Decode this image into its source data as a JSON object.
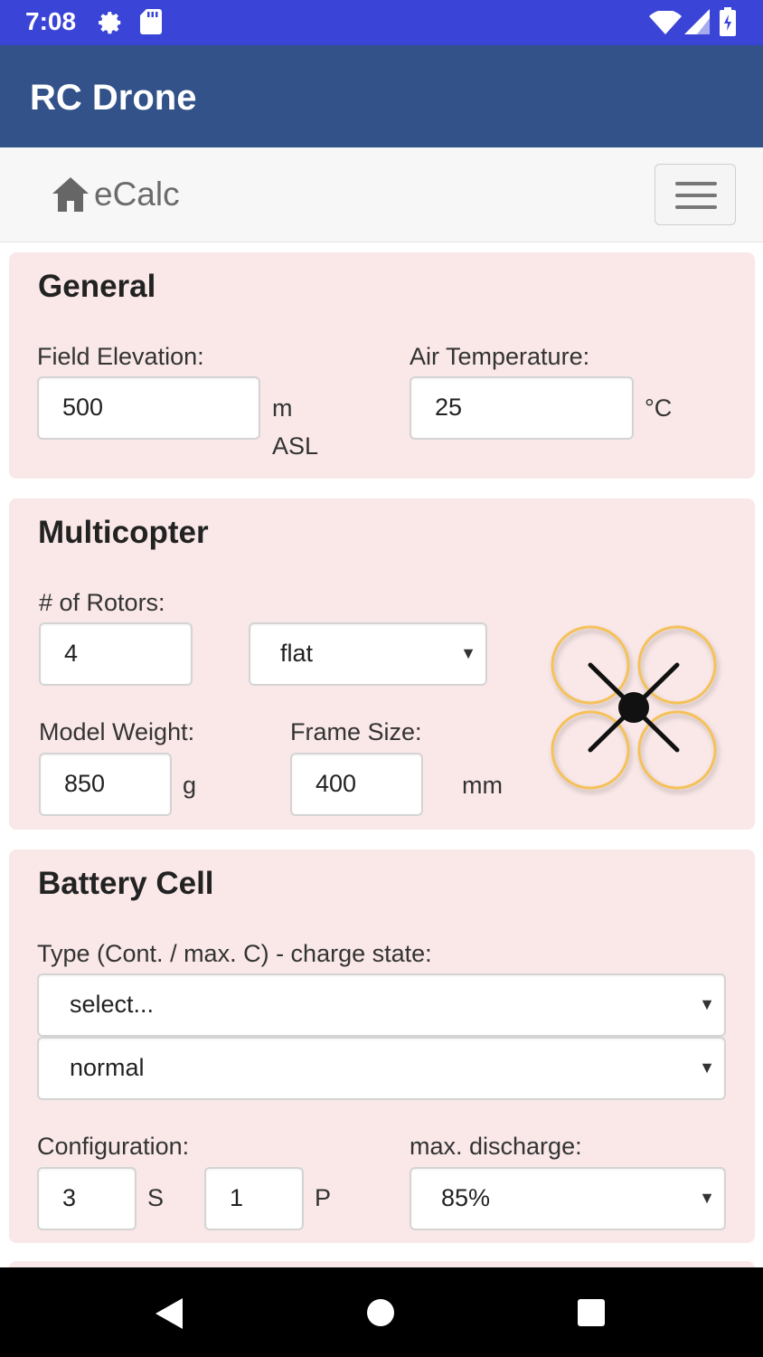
{
  "status_bar": {
    "time": "7:08"
  },
  "app": {
    "title": "RC Drone"
  },
  "nav": {
    "brand": "eCalc"
  },
  "general": {
    "title": "General",
    "field_elevation": {
      "label": "Field Elevation:",
      "value": "500",
      "unit_line1": "m",
      "unit_line2": "ASL"
    },
    "air_temperature": {
      "label": "Air Temperature:",
      "value": "25",
      "unit": "°C"
    }
  },
  "multicopter": {
    "title": "Multicopter",
    "rotors": {
      "label": "# of Rotors:",
      "value": "4"
    },
    "layout": {
      "value": "flat"
    },
    "model_weight": {
      "label": "Model Weight:",
      "value": "850",
      "unit": "g"
    },
    "frame_size": {
      "label": "Frame Size:",
      "value": "400",
      "unit": "mm"
    }
  },
  "battery": {
    "title": "Battery Cell",
    "type_label": "Type (Cont. / max. C) - charge state:",
    "type_value": "select...",
    "charge_value": "normal",
    "configuration": {
      "label": "Configuration:",
      "s_value": "3",
      "s_unit": "S",
      "p_value": "1",
      "p_unit": "P"
    },
    "max_discharge": {
      "label": "max. discharge:",
      "value": "85%"
    }
  },
  "colors": {
    "status_bar": "#3a45d8",
    "app_bar": "#325289",
    "card_bg": "#fae8e8",
    "rotor_ring": "#f5c15a"
  },
  "icons": [
    "gear-icon",
    "sd-card-icon",
    "wifi-icon",
    "signal-icon",
    "battery-icon",
    "home-icon",
    "menu-icon",
    "quadcopter-icon",
    "back-icon",
    "home-nav-icon",
    "recents-icon"
  ]
}
